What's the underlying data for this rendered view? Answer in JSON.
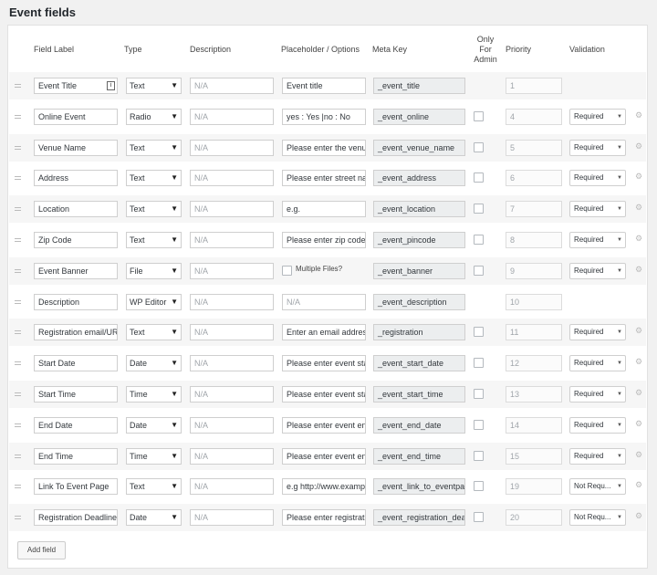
{
  "section_title": "Event fields",
  "columns": {
    "field_label": "Field Label",
    "type": "Type",
    "description": "Description",
    "placeholder": "Placeholder / Options",
    "meta_key": "Meta Key",
    "only_admin_1": "Only",
    "only_admin_2": "For",
    "only_admin_3": "Admin",
    "priority": "Priority",
    "validation": "Validation"
  },
  "rows": [
    {
      "label": "Event Title",
      "type": "Text",
      "description": "N/A",
      "placeholder": "Event title",
      "meta_key": "_event_title",
      "priority": "1",
      "validation": "",
      "has_edit_icon": true
    },
    {
      "label": "Online Event",
      "type": "Radio",
      "description": "N/A",
      "placeholder": "yes : Yes |no : No",
      "meta_key": "_event_online",
      "priority": "4",
      "validation": "Required"
    },
    {
      "label": "Venue Name",
      "type": "Text",
      "description": "N/A",
      "placeholder": "Please enter the venue",
      "meta_key": "_event_venue_name",
      "priority": "5",
      "validation": "Required"
    },
    {
      "label": "Address",
      "type": "Text",
      "description": "N/A",
      "placeholder": "Please enter street nan",
      "meta_key": "_event_address",
      "priority": "6",
      "validation": "Required"
    },
    {
      "label": "Location",
      "type": "Text",
      "description": "N/A",
      "placeholder": "e.g.",
      "meta_key": "_event_location",
      "priority": "7",
      "validation": "Required"
    },
    {
      "label": "Zip Code",
      "type": "Text",
      "description": "N/A",
      "placeholder": "Please enter zip code (",
      "meta_key": "_event_pincode",
      "priority": "8",
      "validation": "Required"
    },
    {
      "label": "Event Banner",
      "type": "File",
      "description": "N/A",
      "placeholder": "Multiple Files?",
      "meta_key": "_event_banner",
      "priority": "9",
      "validation": "Required",
      "placeholder_is_checkbox": true
    },
    {
      "label": "Description",
      "type": "WP Editor",
      "description": "N/A",
      "placeholder": "N/A",
      "meta_key": "_event_description",
      "priority": "10",
      "validation": ""
    },
    {
      "label": "Registration email/URL",
      "type": "Text",
      "description": "N/A",
      "placeholder": "Enter an email address",
      "meta_key": "_registration",
      "priority": "11",
      "validation": "Required"
    },
    {
      "label": "Start Date",
      "type": "Date",
      "description": "N/A",
      "placeholder": "Please enter event star",
      "meta_key": "_event_start_date",
      "priority": "12",
      "validation": "Required"
    },
    {
      "label": "Start Time",
      "type": "Time",
      "description": "N/A",
      "placeholder": "Please enter event star",
      "meta_key": "_event_start_time",
      "priority": "13",
      "validation": "Required"
    },
    {
      "label": "End Date",
      "type": "Date",
      "description": "N/A",
      "placeholder": "Please enter event end",
      "meta_key": "_event_end_date",
      "priority": "14",
      "validation": "Required"
    },
    {
      "label": "End Time",
      "type": "Time",
      "description": "N/A",
      "placeholder": "Please enter event end",
      "meta_key": "_event_end_time",
      "priority": "15",
      "validation": "Required"
    },
    {
      "label": "Link To Event Page",
      "type": "Text",
      "description": "N/A",
      "placeholder": "e.g http://www.exampl",
      "meta_key": "_event_link_to_eventpage",
      "priority": "19",
      "validation": "Not Requ..."
    },
    {
      "label": "Registration Deadline",
      "type": "Date",
      "description": "N/A",
      "placeholder": "Please enter registratic",
      "meta_key": "_event_registration_deadl",
      "priority": "20",
      "validation": "Not Requ..."
    }
  ],
  "add_field_label": "Add field"
}
